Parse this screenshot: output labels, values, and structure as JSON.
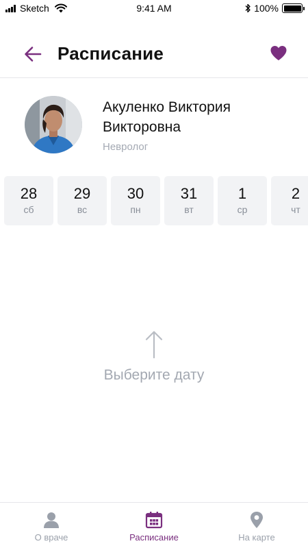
{
  "status_bar": {
    "carrier": "Sketch",
    "time": "9:41 AM",
    "battery": "100%"
  },
  "header": {
    "title": "Расписание",
    "back_icon": "arrow-left-icon",
    "favorite_icon": "heart-icon"
  },
  "doctor": {
    "name_line1": "Акуленко Виктория",
    "name_line2": "Викторовна",
    "specialty": "Невролог"
  },
  "dates": [
    {
      "day": "28",
      "weekday": "сб"
    },
    {
      "day": "29",
      "weekday": "вс"
    },
    {
      "day": "30",
      "weekday": "пн"
    },
    {
      "day": "31",
      "weekday": "вт"
    },
    {
      "day": "1",
      "weekday": "ср"
    },
    {
      "day": "2",
      "weekday": "чт"
    }
  ],
  "empty_state": {
    "text": "Выберите дату",
    "icon": "arrow-up-icon"
  },
  "tabbar": {
    "tabs": [
      {
        "label": "О враче",
        "icon": "person-icon",
        "active": false
      },
      {
        "label": "Расписание",
        "icon": "calendar-icon",
        "active": true
      },
      {
        "label": "На карте",
        "icon": "map-pin-icon",
        "active": false
      }
    ]
  },
  "colors": {
    "accent": "#7a2f7f",
    "inactive": "#9aa0aa",
    "card_bg": "#f2f3f5",
    "muted_text": "#a3a8b1"
  }
}
